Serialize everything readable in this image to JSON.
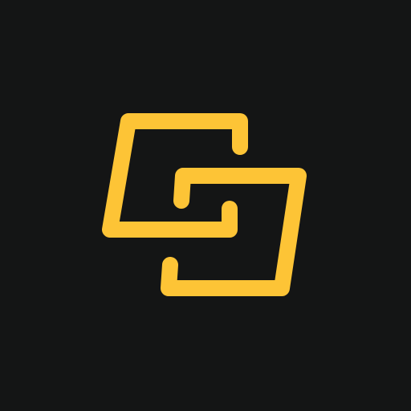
{
  "colors": {
    "background": "#141515",
    "accent": "#FDC436"
  },
  "logo": {
    "icon": "interlocking-brackets-logo-icon"
  }
}
